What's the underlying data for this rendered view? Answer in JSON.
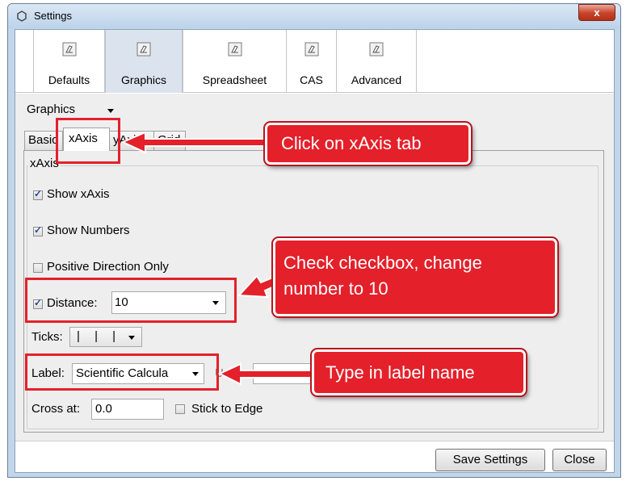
{
  "window": {
    "title": "Settings",
    "close_label": "x"
  },
  "toolbar": {
    "items": [
      {
        "label": "Defaults",
        "icon": "eraser-icon"
      },
      {
        "label": "Graphics",
        "icon": "eraser-icon",
        "selected": true
      },
      {
        "label": "Spreadsheet",
        "icon": "eraser-icon"
      },
      {
        "label": "CAS",
        "icon": "eraser-icon"
      },
      {
        "label": "Advanced",
        "icon": "eraser-icon"
      }
    ]
  },
  "view_select": {
    "value": "Graphics"
  },
  "tabs": {
    "basic": "Basic",
    "xaxis": "xAxis",
    "yaxis": "yAxis",
    "grid": "Grid"
  },
  "xaxis_panel": {
    "group_title": "xAxis",
    "show_axis": {
      "label": "Show xAxis",
      "checked": true
    },
    "show_numbers": {
      "label": "Show Numbers",
      "checked": true
    },
    "positive_only": {
      "label": "Positive Direction Only",
      "checked": false
    },
    "distance": {
      "label": "Distance:",
      "checked": true,
      "value": "10"
    },
    "ticks": {
      "label": "Ticks:",
      "value": "| | |"
    },
    "label": {
      "label": "Label:",
      "value": "Scientific Calcula"
    },
    "unit": {
      "label": "Unit:",
      "value": ""
    },
    "cross_at": {
      "label": "Cross at:",
      "value": "0.0"
    },
    "stick_to_edge": {
      "label": "Stick to Edge",
      "checked": false
    }
  },
  "footer": {
    "save_label": "Save Settings",
    "close_label": "Close"
  },
  "annotations": {
    "tab_note": "Click on xAxis tab",
    "distance_note_line1": "Check checkbox, change",
    "distance_note_line2": "number to 10",
    "label_note": "Type in label name"
  },
  "colors": {
    "annotation_red": "#e4202a",
    "selected_tool": "#dbe4ee"
  }
}
